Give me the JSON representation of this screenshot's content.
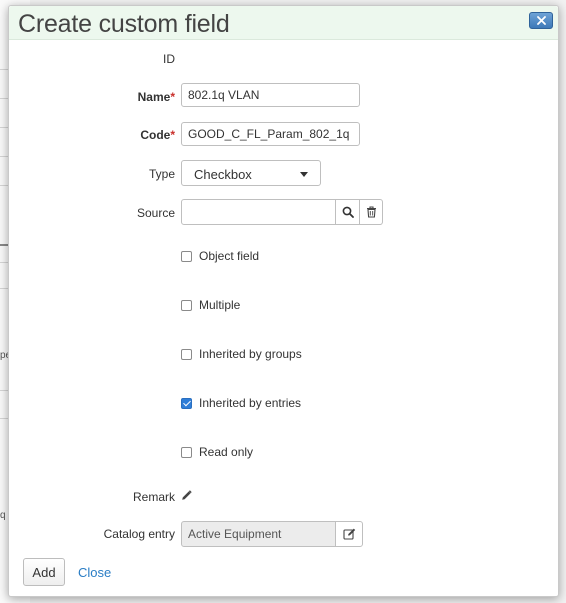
{
  "background_page": {
    "fragment_a": "pe",
    "fragment_b": "q"
  },
  "dialog": {
    "title": "Create custom field",
    "close_icon": "close-x-icon",
    "accent_color": "#2f7ed8"
  },
  "form": {
    "id_label": "ID",
    "name_label": "Name",
    "name_required_mark": "*",
    "name_value": "802.1q VLAN",
    "code_label": "Code",
    "code_required_mark": "*",
    "code_value": "GOOD_C_FL_Param_802_1q",
    "type_label": "Type",
    "type_value": "Checkbox",
    "source_label": "Source",
    "source_value": "",
    "source_search_icon": "search-icon",
    "source_clear_icon": "trash-icon",
    "checkboxes": [
      {
        "label": "Object field",
        "checked": false
      },
      {
        "label": "Multiple",
        "checked": false
      },
      {
        "label": "Inherited by groups",
        "checked": false
      },
      {
        "label": "Inherited by entries",
        "checked": true
      },
      {
        "label": "Read only",
        "checked": false
      }
    ],
    "remark_label": "Remark",
    "remark_icon": "pencil-icon",
    "catalog_label": "Catalog entry",
    "catalog_value": "Active Equipment",
    "catalog_edit_icon": "edit-icon"
  },
  "footer": {
    "add_label": "Add",
    "close_label": "Close"
  }
}
